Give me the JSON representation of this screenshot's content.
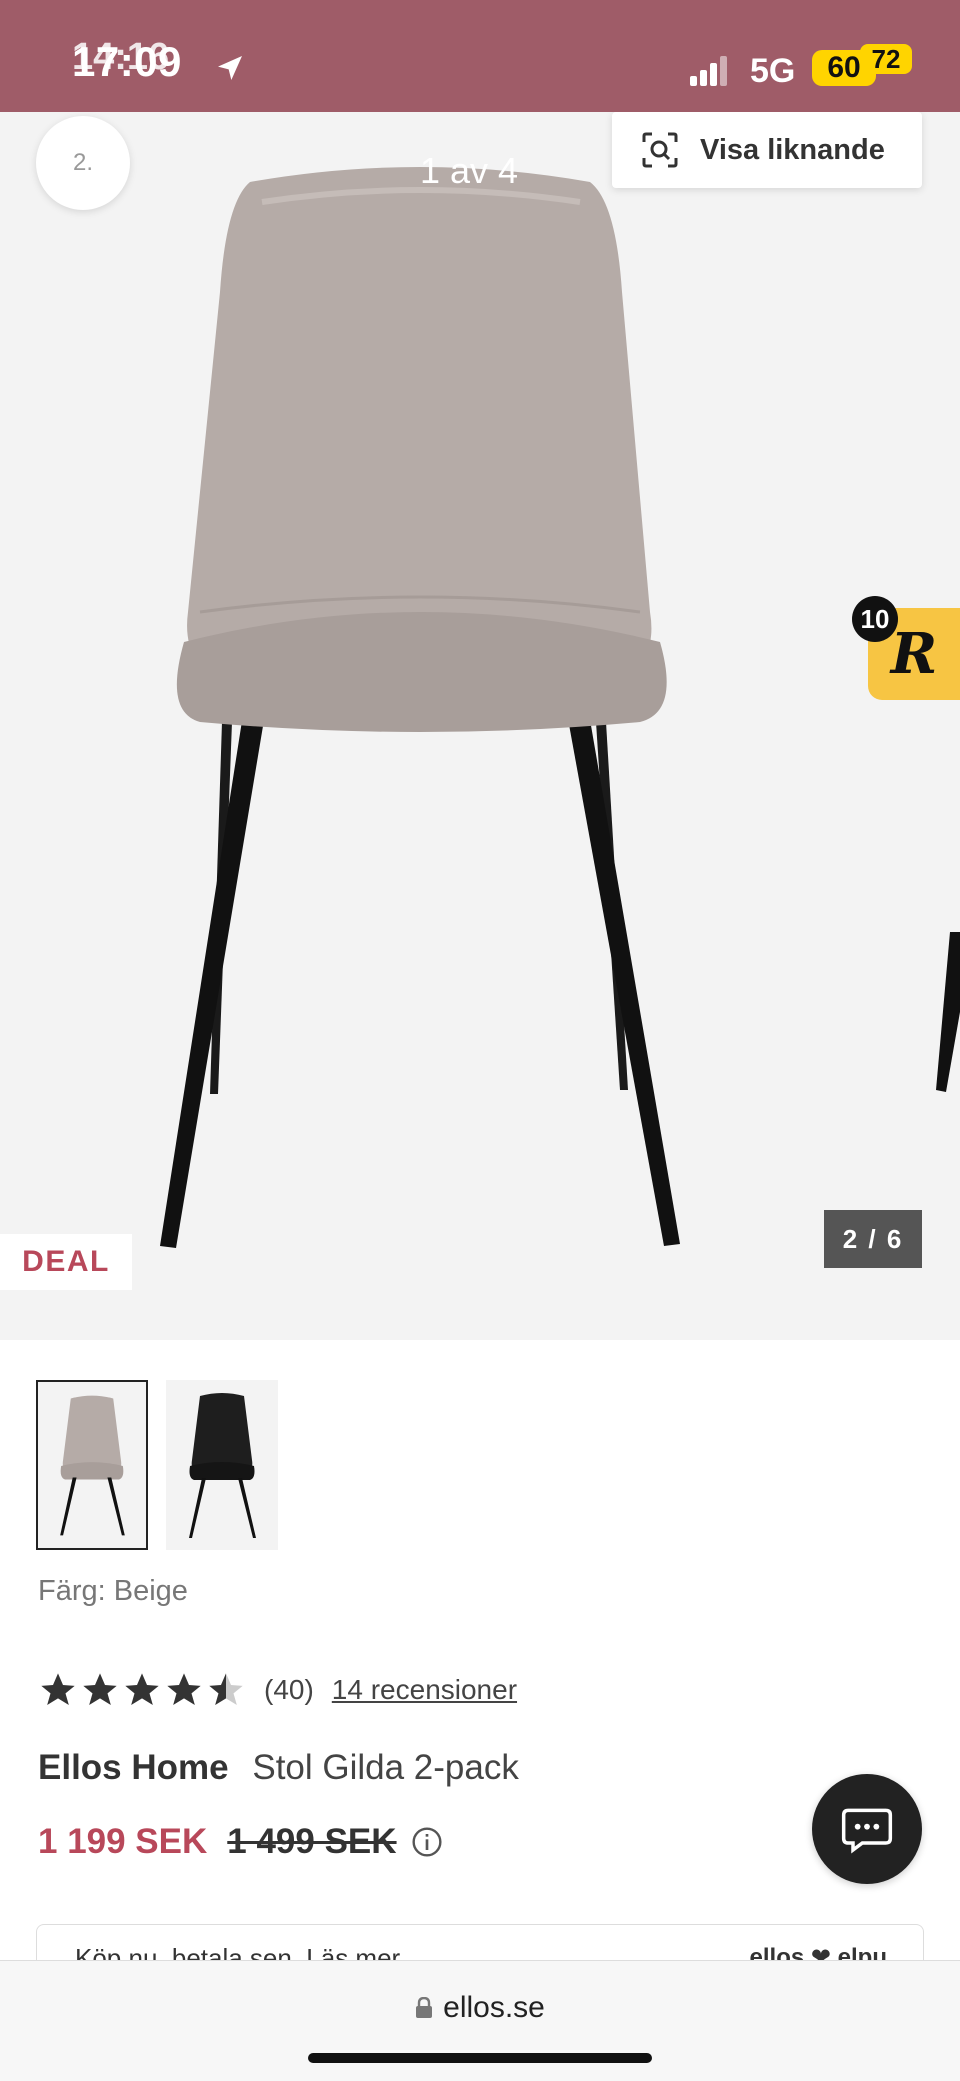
{
  "status_bar": {
    "time": "17:09",
    "time_ghost": "14:16",
    "network": "5G",
    "battery": "60",
    "battery_badge": "72",
    "background": "#9f5c68"
  },
  "hero": {
    "image_counter": "1 av 4",
    "back_label": "2.",
    "visa_liknande_label": "Visa liknande",
    "deal_label": "DEAL",
    "slide_counter": "2 / 6",
    "reward_badge_letter": "R",
    "reward_badge_count": "10",
    "chair_color": "#b5aba7"
  },
  "thumbnails": [
    {
      "name": "beige",
      "color": "#b5aba7",
      "selected": true
    },
    {
      "name": "black",
      "color": "#1e1e1e",
      "selected": false
    }
  ],
  "product": {
    "color_label": "Färg: Beige",
    "rating_value": 4.5,
    "rating_count": "(40)",
    "reviews_link": "14 recensioner",
    "brand": "Ellos Home",
    "name": "Stol Gilda 2-pack",
    "price_now": "1 199 SEK",
    "price_old": "1 499 SEK",
    "accent_color": "#b8485a"
  },
  "payment": {
    "text": "Köp nu, betala sen. Läs mer",
    "logo": "ellos ❤ elpu"
  },
  "browser": {
    "url": "ellos.se"
  }
}
